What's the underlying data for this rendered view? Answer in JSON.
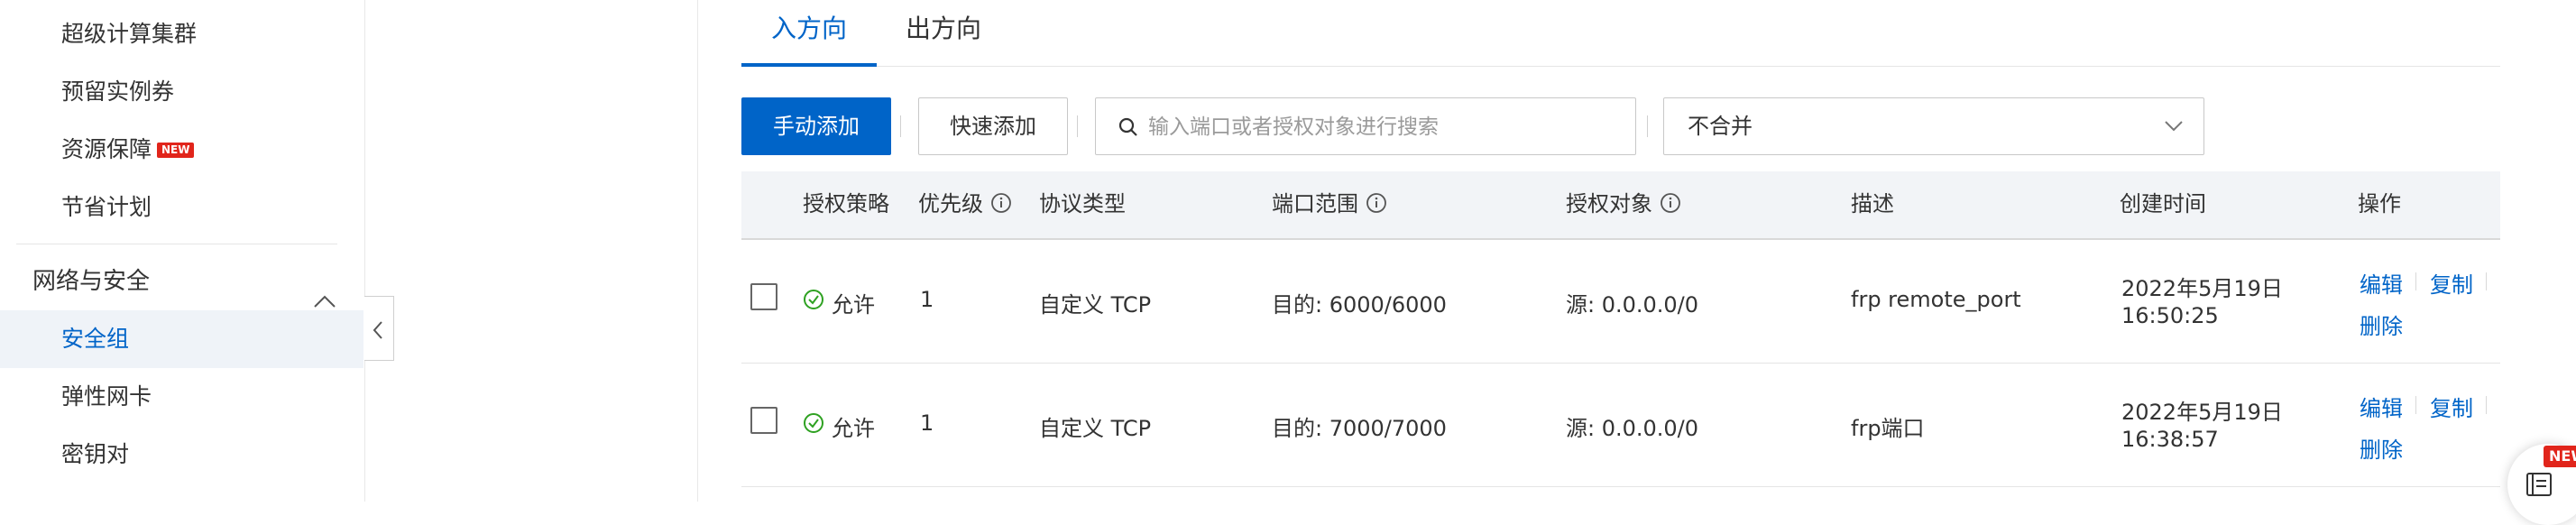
{
  "sidebar": {
    "items": [
      {
        "label": "超级计算集群"
      },
      {
        "label": "预留实例券"
      },
      {
        "label": "资源保障",
        "badge": "NEW"
      },
      {
        "label": "节省计划"
      }
    ],
    "group": {
      "label": "网络与安全",
      "expanded": true
    },
    "group_items": [
      {
        "label": "安全组",
        "active": true
      },
      {
        "label": "弹性网卡"
      },
      {
        "label": "密钥对"
      }
    ]
  },
  "tabs": [
    {
      "label": "入方向",
      "active": true
    },
    {
      "label": "出方向"
    }
  ],
  "toolbar": {
    "manual_add_label": "手动添加",
    "quick_add_label": "快速添加",
    "search_placeholder": "输入端口或者授权对象进行搜索",
    "merge_select_value": "不合并"
  },
  "table": {
    "headers": {
      "policy": "授权策略",
      "priority": "优先级",
      "protocol": "协议类型",
      "port_range": "端口范围",
      "auth_object": "授权对象",
      "description": "描述",
      "created": "创建时间",
      "actions": "操作"
    },
    "rows": [
      {
        "policy": "允许",
        "priority": "1",
        "protocol": "自定义 TCP",
        "port_range": "目的: 6000/6000",
        "auth_object": "源: 0.0.0.0/0",
        "description": "frp remote_port",
        "created_date": "2022年5月19日",
        "created_time": "16:50:25",
        "actions": {
          "edit": "编辑",
          "copy": "复制",
          "delete": "删除"
        }
      },
      {
        "policy": "允许",
        "priority": "1",
        "protocol": "自定义 TCP",
        "port_range": "目的: 7000/7000",
        "auth_object": "源: 0.0.0.0/0",
        "description": "frp端口",
        "created_date": "2022年5月19日",
        "created_time": "16:38:57",
        "actions": {
          "edit": "编辑",
          "copy": "复制",
          "delete": "删除"
        }
      }
    ]
  },
  "floating_widget": {
    "badge": "NEW",
    "icon": "notebook-icon"
  },
  "colors": {
    "accent": "#0064c8",
    "badge_red": "#e1251b",
    "allow_green": "#2ea121",
    "active_bg": "#eff3f8"
  }
}
